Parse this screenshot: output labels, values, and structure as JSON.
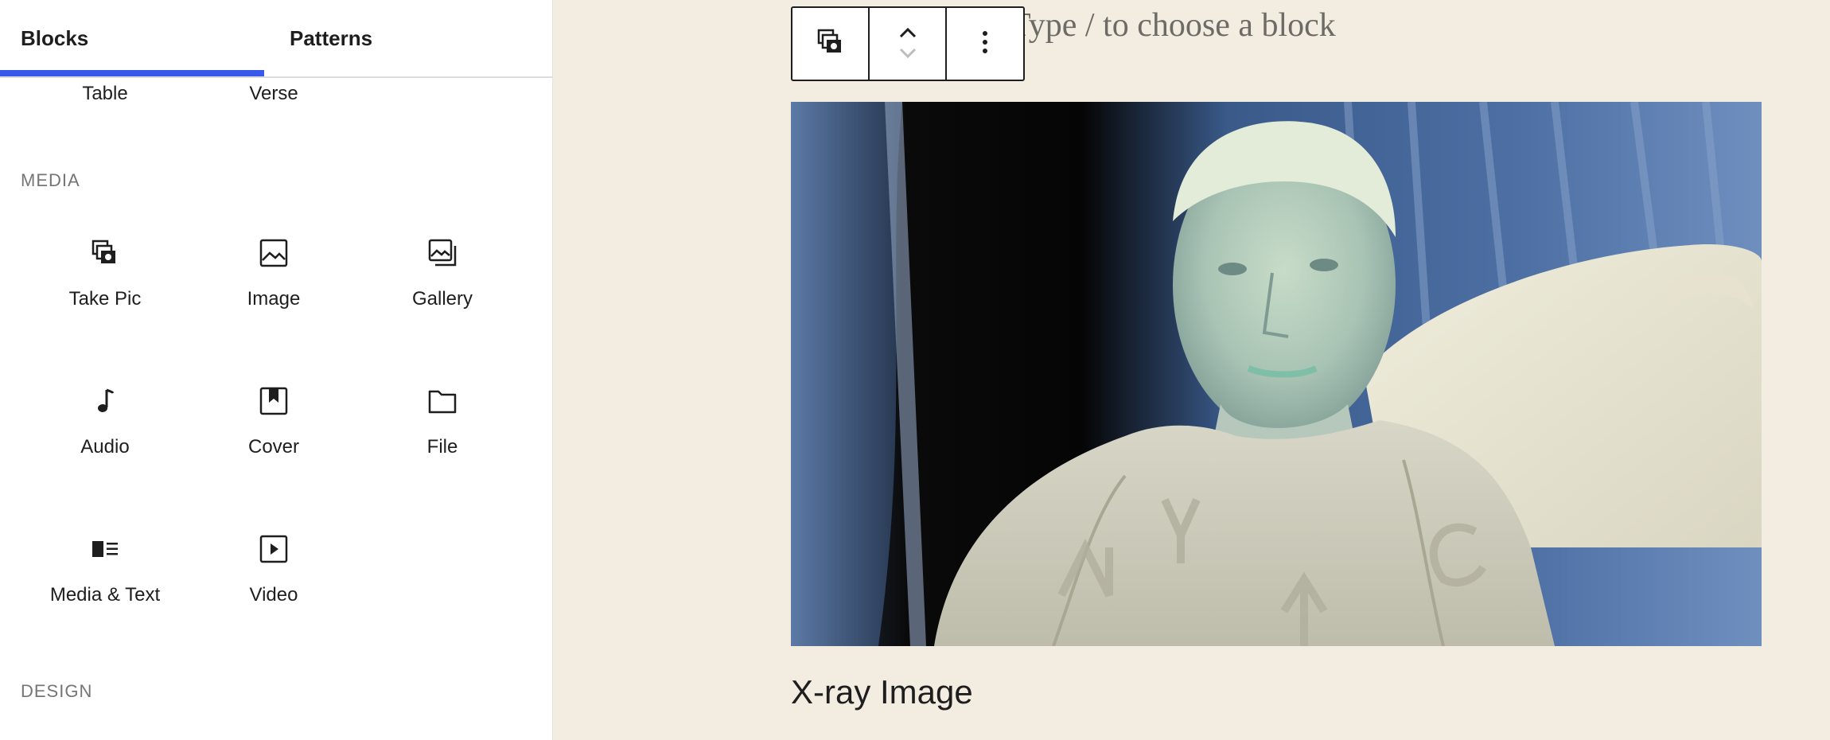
{
  "sidebar": {
    "tabs": [
      {
        "label": "Blocks",
        "active": true
      },
      {
        "label": "Patterns",
        "active": false
      }
    ],
    "accent_color": "#3858e9",
    "cut_off_items": [
      {
        "label": "Table"
      },
      {
        "label": "Verse"
      }
    ],
    "sections": [
      {
        "heading": "MEDIA",
        "items": [
          {
            "label": "Take Pic",
            "icon": "camera-gallery-icon"
          },
          {
            "label": "Image",
            "icon": "image-icon"
          },
          {
            "label": "Gallery",
            "icon": "gallery-icon"
          },
          {
            "label": "Audio",
            "icon": "audio-note-icon"
          },
          {
            "label": "Cover",
            "icon": "cover-icon"
          },
          {
            "label": "File",
            "icon": "folder-icon"
          },
          {
            "label": "Media & Text",
            "icon": "media-text-icon"
          },
          {
            "label": "Video",
            "icon": "video-icon"
          }
        ]
      },
      {
        "heading": "DESIGN",
        "items": []
      }
    ]
  },
  "canvas": {
    "placeholder": "Type / to choose a block",
    "toolbar": {
      "block_icon": "take-pic-block-icon",
      "move_up_icon": "chevron-up-icon",
      "move_down_icon": "chevron-down-icon",
      "options_icon": "more-vertical-icon"
    },
    "image_caption": "X-ray Image",
    "background_color": "#f3ede1"
  }
}
